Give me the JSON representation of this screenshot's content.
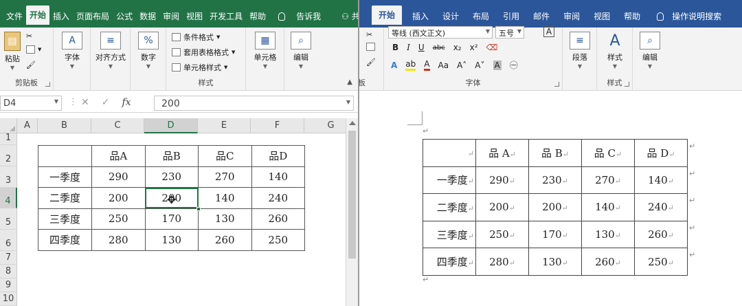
{
  "excel": {
    "tabs": [
      "文件",
      "开始",
      "插入",
      "页面布局",
      "公式",
      "数据",
      "审阅",
      "视图",
      "开发工具",
      "帮助"
    ],
    "tell_me": "告诉我",
    "share": "共享",
    "ribbon": {
      "clipboard": {
        "paste": "粘贴",
        "label": "剪贴板"
      },
      "font": "字体",
      "alignment": "对齐方式",
      "number": "数字",
      "number_icon": "%",
      "styles": {
        "conditional": "条件格式",
        "table_format": "套用表格格式",
        "cell_styles": "单元格样式",
        "label": "样式"
      },
      "cells": "单元格",
      "editing": "编辑"
    },
    "formula_bar": {
      "name_box": "D4",
      "cancel": "✕",
      "enter": "✓",
      "fx": "fx",
      "value": "200"
    },
    "columns": [
      "A",
      "B",
      "C",
      "D",
      "E",
      "F",
      "G"
    ],
    "rows": [
      "1",
      "2",
      "3",
      "4",
      "5",
      "6",
      "7",
      "8",
      "9",
      "10"
    ],
    "selected_column": "D",
    "selected_row": "4",
    "table": {
      "headers": [
        "",
        "品A",
        "品B",
        "品C",
        "品D"
      ],
      "rows": [
        [
          "一季度",
          "290",
          "230",
          "270",
          "140"
        ],
        [
          "二季度",
          "200",
          "200",
          "140",
          "240"
        ],
        [
          "三季度",
          "250",
          "170",
          "130",
          "260"
        ],
        [
          "四季度",
          "280",
          "130",
          "260",
          "250"
        ]
      ]
    }
  },
  "word": {
    "tabs": [
      "开始",
      "插入",
      "设计",
      "布局",
      "引用",
      "邮件",
      "审阅",
      "视图",
      "帮助"
    ],
    "tell_me": "操作说明搜索",
    "ribbon": {
      "font_name": "等线 (西文正文)",
      "font_size": "五号",
      "font_size_a": "A",
      "bold": "B",
      "italic": "I",
      "underline": "U",
      "strike": "abc",
      "sub": "x₂",
      "sup": "x²",
      "font_label": "字体",
      "paragraph": "段落",
      "styles": "样式",
      "styles_label": "样式",
      "editing": "编辑",
      "clip_label": "板"
    },
    "para_mark": "↵",
    "table": {
      "headers": [
        "",
        "品 A",
        "品 B",
        "品 C",
        "品 D"
      ],
      "rows": [
        [
          "一季度",
          "290",
          "230",
          "270",
          "140"
        ],
        [
          "二季度",
          "200",
          "200",
          "140",
          "240"
        ],
        [
          "三季度",
          "250",
          "170",
          "130",
          "260"
        ],
        [
          "四季度",
          "280",
          "130",
          "260",
          "250"
        ]
      ]
    }
  },
  "colors": {
    "excel_green": "#217346",
    "word_blue": "#2b579a"
  }
}
